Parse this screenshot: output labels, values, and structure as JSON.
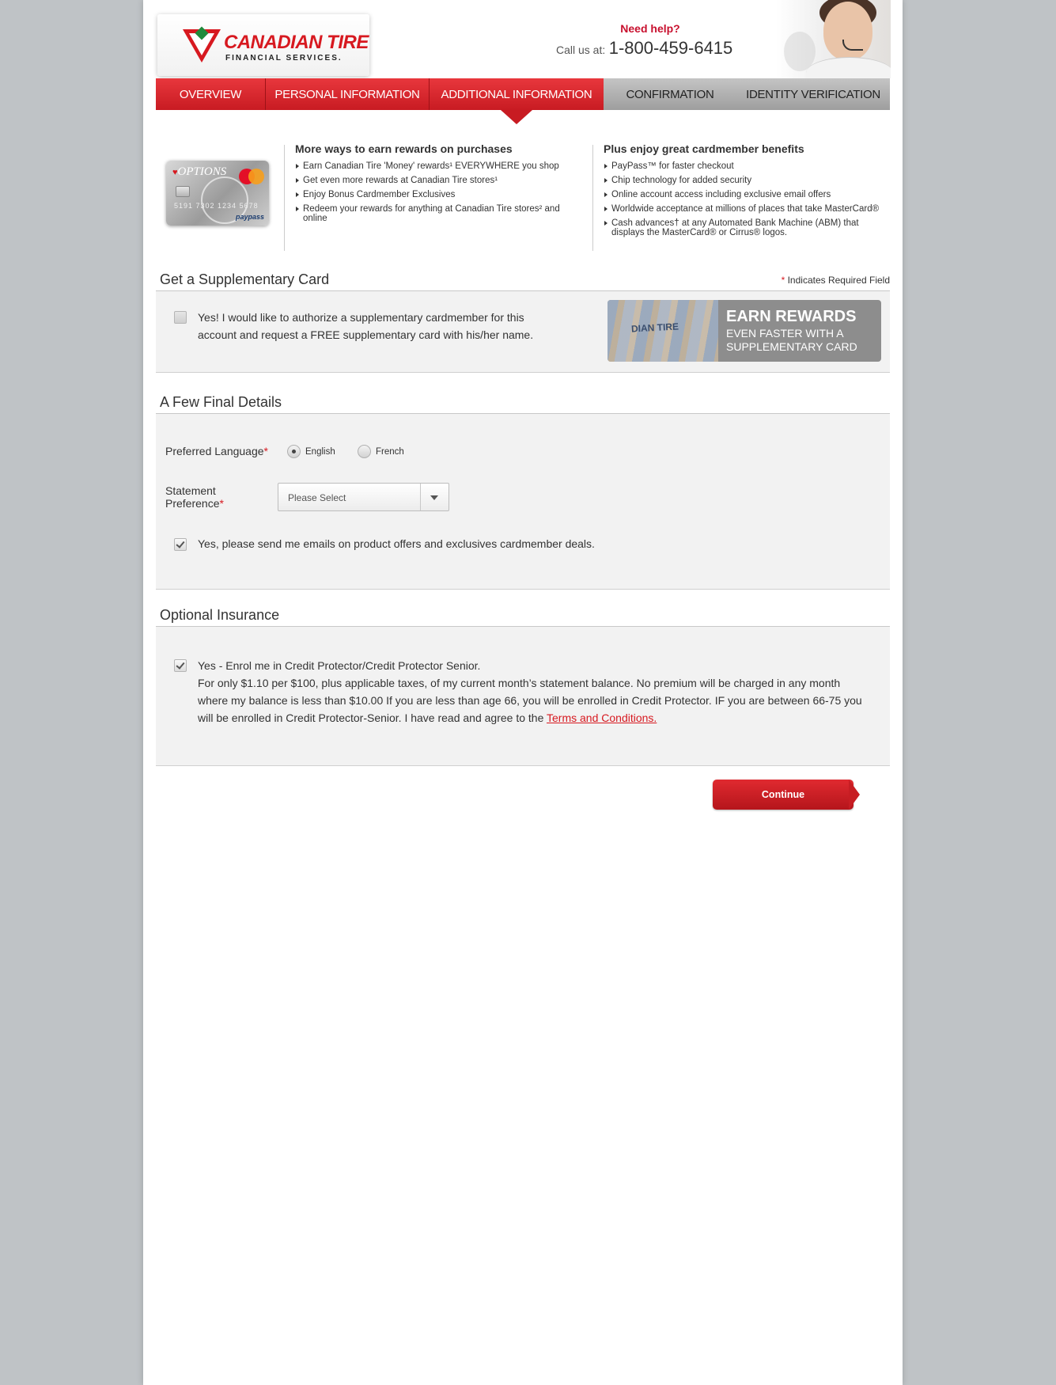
{
  "header": {
    "logo_name": "CANADIAN TIRE",
    "logo_sub": "FINANCIAL SERVICES.",
    "help_label": "Need help?",
    "call_label": "Call us at:",
    "phone": "1-800-459-6415"
  },
  "nav": {
    "tabs": [
      {
        "label": "OVERVIEW",
        "state": "completed"
      },
      {
        "label": "PERSONAL INFORMATION",
        "state": "completed"
      },
      {
        "label": "ADDITIONAL INFORMATION",
        "state": "active"
      },
      {
        "label": "CONFIRMATION",
        "state": "pending"
      },
      {
        "label": "IDENTITY VERIFICATION",
        "state": "pending"
      }
    ]
  },
  "card": {
    "brand": "OPTIONS",
    "number": "5191 7302 1234 5678",
    "paypass": "paypass",
    "network": "MasterCard"
  },
  "benefits": {
    "rewards_title": "More ways to earn rewards on purchases",
    "rewards_items": [
      "Earn Canadian Tire 'Money' rewards¹ EVERYWHERE you shop",
      "Get even more rewards at Canadian Tire stores¹",
      "Enjoy Bonus Cardmember Exclusives",
      "Redeem your rewards for anything at Canadian Tire stores² and online"
    ],
    "cardmember_title": "Plus enjoy great cardmember benefits",
    "cardmember_items": [
      "PayPass™ for faster checkout",
      "Chip technology for added security",
      "Online account access including exclusive email offers",
      "Worldwide acceptance at millions of places that take MasterCard®",
      "Cash advances† at any Automated Bank Machine (ABM) that displays the MasterCard® or Cirrus® logos."
    ]
  },
  "supplementary": {
    "title": "Get a Supplementary Card",
    "required_note": "Indicates Required Field",
    "checkbox_text": "Yes! I would like to authorize a supplementary cardmember for this account and request a FREE supplementary card with his/her name.",
    "checked": false,
    "promo_heading": "EARN REWARDS",
    "promo_sub": "EVEN FASTER WITH A SUPPLEMENTARY CARD",
    "promo_bill_text": "DIAN TIRE"
  },
  "final_details": {
    "title": "A Few Final Details",
    "language_label": "Preferred Language",
    "language_options": [
      "English",
      "French"
    ],
    "language_selected": "English",
    "statement_label_1": "Statement",
    "statement_label_2": "Preference",
    "statement_value": "Please Select",
    "email_text": "Yes, please send me emails on product offers and exclusives cardmember deals.",
    "email_checked": true
  },
  "insurance": {
    "title": "Optional Insurance",
    "checkbox_title": "Yes - Enrol me in Credit Protector/Credit Protector Senior.",
    "body": "For only $1.10 per $100, plus applicable taxes, of my current month’s statement balance. No premium will be charged in any month where my balance is less than $10.00 If you are less than age 66, you will be enrolled in Credit Protector. IF you are between 66-75 you will be enrolled in Credit Protector-Senior. I have read and agree to the",
    "terms_link": "Terms and Conditions.",
    "checked": true
  },
  "actions": {
    "continue_label": "Continue"
  },
  "colors": {
    "brand_red": "#d71920",
    "panel_bg": "#f2f2f2",
    "page_bg": "#bfc3c6"
  }
}
